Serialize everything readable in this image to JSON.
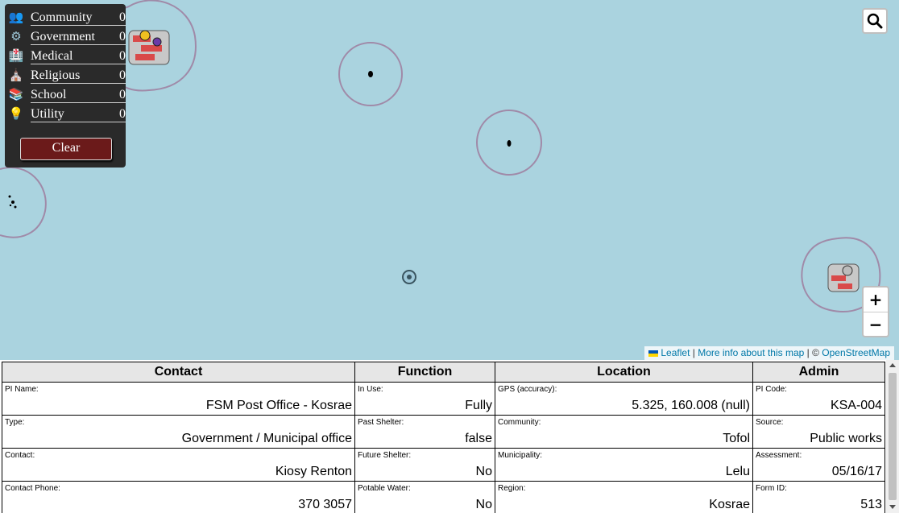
{
  "legend": {
    "items": [
      {
        "label": "Community",
        "count": "0",
        "icon": "people-icon",
        "glyph": "👥"
      },
      {
        "label": "Government",
        "count": "0",
        "icon": "gear-icon",
        "glyph": "⚙"
      },
      {
        "label": "Medical",
        "count": "0",
        "icon": "hospital-icon",
        "glyph": "🏥"
      },
      {
        "label": "Religious",
        "count": "0",
        "icon": "church-icon",
        "glyph": "⛪"
      },
      {
        "label": "School",
        "count": "0",
        "icon": "books-icon",
        "glyph": "📚"
      },
      {
        "label": "Utility",
        "count": "0",
        "icon": "lightbulb-icon",
        "glyph": "💡"
      }
    ],
    "clear_label": "Clear"
  },
  "controls": {
    "zoom_in": "+",
    "zoom_out": "−"
  },
  "attribution": {
    "leaflet": "Leaflet",
    "sep1": "|",
    "more_info": "More info about this map",
    "sep2": "| ©",
    "osm": "OpenStreetMap"
  },
  "colors": {
    "water": "#aad3df",
    "boundary": "#a08aa8",
    "legend_bg": "#2a2a2a",
    "clear_button": "#6b1a1a",
    "link": "#0078a8"
  },
  "table": {
    "headers": [
      "Contact",
      "Function",
      "Location",
      "Admin"
    ],
    "rows": [
      [
        {
          "label": "PI Name:",
          "value": "FSM Post Office - Kosrae"
        },
        {
          "label": "In Use:",
          "value": "Fully"
        },
        {
          "label": "GPS (accuracy):",
          "value": "5.325, 160.008 (null)"
        },
        {
          "label": "PI Code:",
          "value": "KSA-004"
        }
      ],
      [
        {
          "label": "Type:",
          "value": "Government / Municipal office"
        },
        {
          "label": "Past Shelter:",
          "value": "false"
        },
        {
          "label": "Community:",
          "value": "Tofol"
        },
        {
          "label": "Source:",
          "value": "Public works"
        }
      ],
      [
        {
          "label": "Contact:",
          "value": "Kiosy Renton"
        },
        {
          "label": "Future Shelter:",
          "value": "No"
        },
        {
          "label": "Municipality:",
          "value": "Lelu"
        },
        {
          "label": "Assessment:",
          "value": "05/16/17"
        }
      ],
      [
        {
          "label": "Contact Phone:",
          "value": "370 3057"
        },
        {
          "label": "Potable Water:",
          "value": "No"
        },
        {
          "label": "Region:",
          "value": "Kosrae"
        },
        {
          "label": "Form ID:",
          "value": "513"
        }
      ]
    ]
  }
}
